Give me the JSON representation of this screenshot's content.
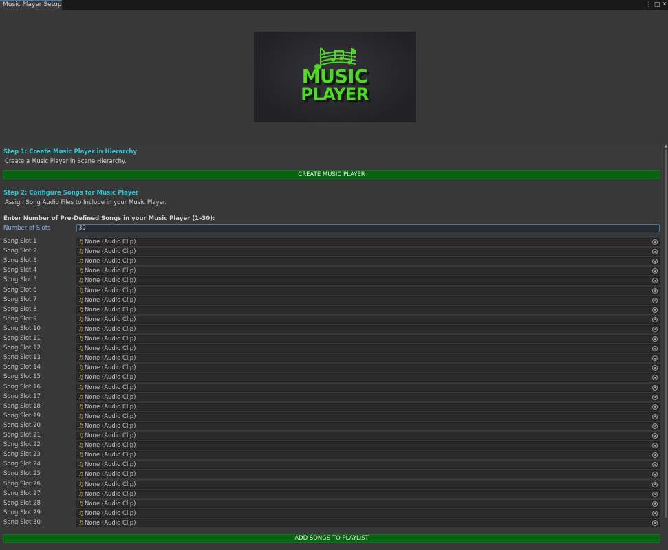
{
  "window": {
    "tab_title": "Music Player Setup",
    "menu_icon": "kebab-menu-icon",
    "maximize_icon": "maximize-icon",
    "close_icon": "close-icon"
  },
  "logo": {
    "line1": "MUSIC",
    "line2": "PLAYER",
    "color": "#52d62a"
  },
  "step1": {
    "title": "Step 1:  Create Music Player in Hierarchy",
    "description": "Create a Music Player in Scene Hierarchy.",
    "button_label": "CREATE MUSIC PLAYER"
  },
  "step2": {
    "title": "Step 2:  Configure Songs for Music Player",
    "description": "Assign Song Audio Files to Include in your Music Player.",
    "prompt": "Enter Number of Pre-Defined Songs in your Music Player (1–30):",
    "slots_label": "Number of Slots",
    "slots_value": "30",
    "button_label": "ADD SONGS TO PLAYLIST"
  },
  "colors": {
    "accent_cyan": "#2ec4d4",
    "button_green": "#0a6312",
    "focus_blue": "#3a79bb"
  },
  "slot_icon": "audio-clip-icon",
  "picker_icon": "object-picker-icon",
  "slots": [
    {
      "label": "Song Slot 1",
      "value": "None (Audio Clip)"
    },
    {
      "label": "Song Slot 2",
      "value": "None (Audio Clip)"
    },
    {
      "label": "Song Slot 3",
      "value": "None (Audio Clip)"
    },
    {
      "label": "Song Slot 4",
      "value": "None (Audio Clip)"
    },
    {
      "label": "Song Slot 5",
      "value": "None (Audio Clip)"
    },
    {
      "label": "Song Slot 6",
      "value": "None (Audio Clip)"
    },
    {
      "label": "Song Slot 7",
      "value": "None (Audio Clip)"
    },
    {
      "label": "Song Slot 8",
      "value": "None (Audio Clip)"
    },
    {
      "label": "Song Slot 9",
      "value": "None (Audio Clip)"
    },
    {
      "label": "Song Slot 10",
      "value": "None (Audio Clip)"
    },
    {
      "label": "Song Slot 11",
      "value": "None (Audio Clip)"
    },
    {
      "label": "Song Slot 12",
      "value": "None (Audio Clip)"
    },
    {
      "label": "Song Slot 13",
      "value": "None (Audio Clip)"
    },
    {
      "label": "Song Slot 14",
      "value": "None (Audio Clip)"
    },
    {
      "label": "Song Slot 15",
      "value": "None (Audio Clip)"
    },
    {
      "label": "Song Slot 16",
      "value": "None (Audio Clip)"
    },
    {
      "label": "Song Slot 17",
      "value": "None (Audio Clip)"
    },
    {
      "label": "Song Slot 18",
      "value": "None (Audio Clip)"
    },
    {
      "label": "Song Slot 19",
      "value": "None (Audio Clip)"
    },
    {
      "label": "Song Slot 20",
      "value": "None (Audio Clip)"
    },
    {
      "label": "Song Slot 21",
      "value": "None (Audio Clip)"
    },
    {
      "label": "Song Slot 22",
      "value": "None (Audio Clip)"
    },
    {
      "label": "Song Slot 23",
      "value": "None (Audio Clip)"
    },
    {
      "label": "Song Slot 24",
      "value": "None (Audio Clip)"
    },
    {
      "label": "Song Slot 25",
      "value": "None (Audio Clip)"
    },
    {
      "label": "Song Slot 26",
      "value": "None (Audio Clip)"
    },
    {
      "label": "Song Slot 27",
      "value": "None (Audio Clip)"
    },
    {
      "label": "Song Slot 28",
      "value": "None (Audio Clip)"
    },
    {
      "label": "Song Slot 29",
      "value": "None (Audio Clip)"
    },
    {
      "label": "Song Slot 30",
      "value": "None (Audio Clip)"
    }
  ]
}
